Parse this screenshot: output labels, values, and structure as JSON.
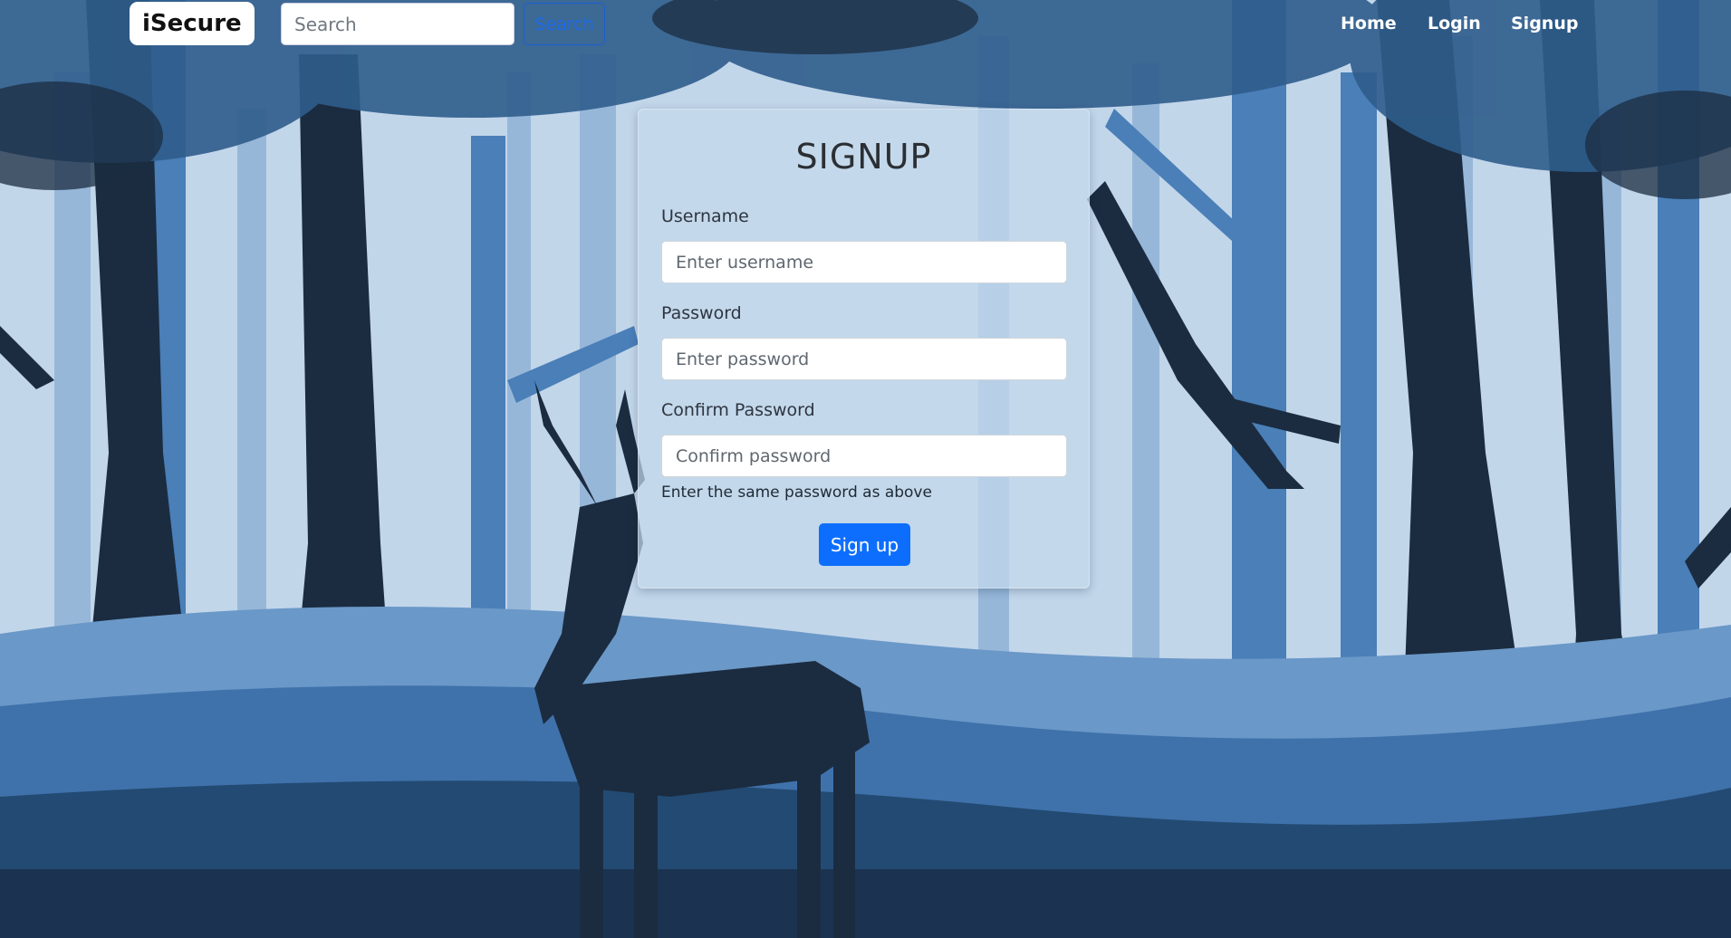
{
  "navbar": {
    "brand": "iSecure",
    "search_placeholder": "Search",
    "search_button": "Search",
    "links": [
      "Home",
      "Login",
      "Signup"
    ]
  },
  "form": {
    "title": "SIGNUP",
    "fields": [
      {
        "label": "Username",
        "placeholder": "Enter username"
      },
      {
        "label": "Password",
        "placeholder": "Enter password"
      },
      {
        "label": "Confirm Password",
        "placeholder": "Confirm password"
      }
    ],
    "help_text": "Enter the same password as above",
    "submit_label": "Sign up"
  },
  "colors": {
    "sky": "#c2d6ea",
    "primary_button": "#0d6efd",
    "tree_dark": "#1b2c40",
    "tree_mid": "#2f5d8c",
    "tree_light": "#4f84bd"
  }
}
